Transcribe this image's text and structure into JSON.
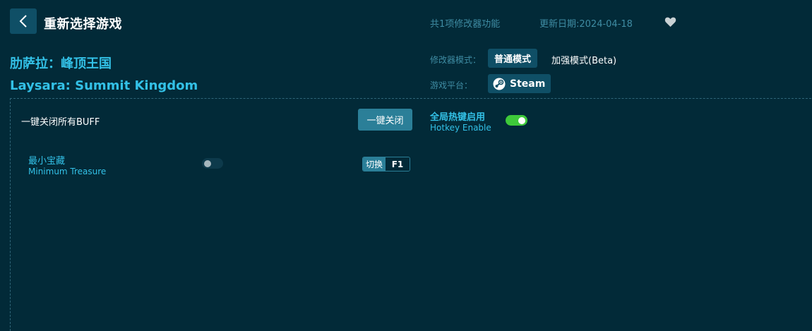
{
  "header": {
    "back_icon": "chevron-left-icon",
    "title": "重新选择游戏",
    "feature_count": "共1项修改器功能",
    "update_date": "更新日期:2024-04-18",
    "favorite_icon": "heart-icon"
  },
  "game": {
    "title_cn": "肋萨拉：峰顶王国",
    "title_en": "Laysara: Summit Kingdom"
  },
  "mode": {
    "label": "修改器模式：",
    "options": [
      "普通模式",
      "加强模式(Beta)"
    ],
    "selected": "普通模式"
  },
  "platform": {
    "label": "游戏平台：",
    "name": "Steam",
    "icon": "steam-icon"
  },
  "controls": {
    "close_all_label": "一键关闭所有BUFF",
    "close_all_button": "一键关闭",
    "hotkey_label_cn": "全局热键启用",
    "hotkey_label_en": "Hotkey Enable",
    "hotkey_enabled": true
  },
  "features": [
    {
      "name_cn": "最小宝藏",
      "name_en": "Minimum Treasure",
      "enabled": false,
      "action": "切换",
      "key": "F1"
    }
  ],
  "colors": {
    "background": "#022a38",
    "accent": "#33c1e7",
    "button": "#0f4f66",
    "button_light": "#2b7f98",
    "toggle_on": "#3ec93a",
    "muted_text": "#3f8ca3"
  }
}
